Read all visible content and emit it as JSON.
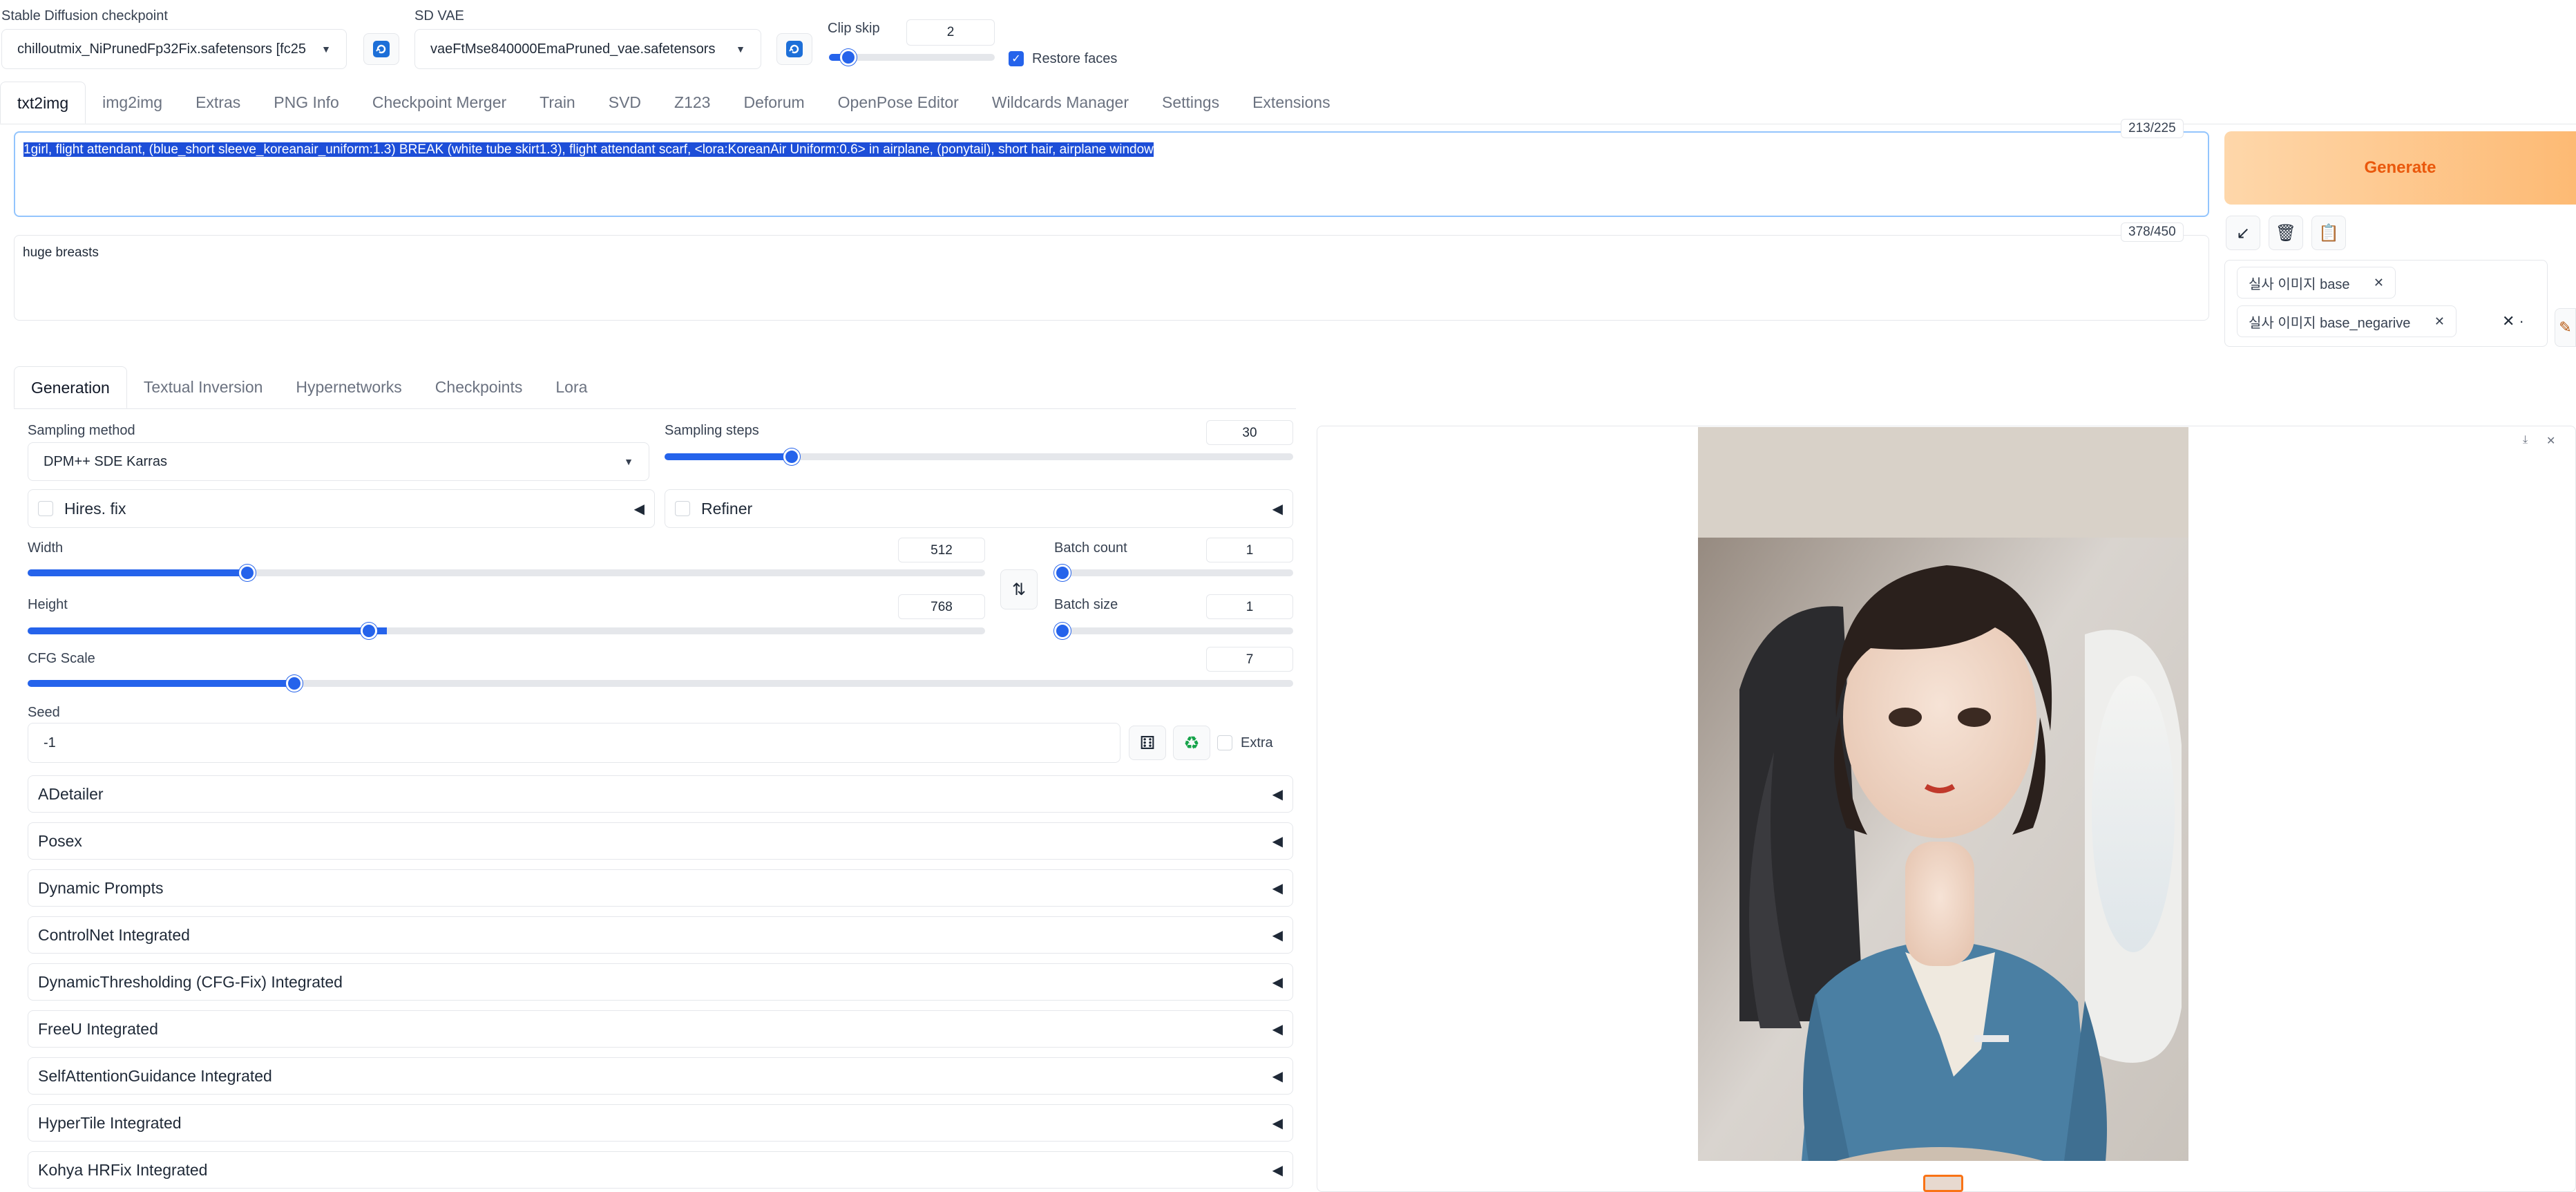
{
  "top": {
    "checkpoint_label": "Stable Diffusion checkpoint",
    "checkpoint_value": "chilloutmix_NiPrunedFp32Fix.safetensors [fc25",
    "vae_label": "SD VAE",
    "vae_value": "vaeFtMse840000EmaPruned_vae.safetensors",
    "clip_label": "Clip skip",
    "clip_value": "2",
    "clip_level": 0.1,
    "restore_faces_label": "Restore faces",
    "restore_faces_checked": true
  },
  "tabs": [
    "txt2img",
    "img2img",
    "Extras",
    "PNG Info",
    "Checkpoint Merger",
    "Train",
    "SVD",
    "Z123",
    "Deforum",
    "OpenPose Editor",
    "Wildcards Manager",
    "Settings",
    "Extensions"
  ],
  "prompt": {
    "text": "1girl, flight attendant, (blue_short sleeve_koreanair_uniform:1.3) BREAK (white tube skirt1.3), flight attendant scarf, <lora:KoreanAir Uniform:0.6> in airplane, (ponytail), short hair, airplane window",
    "counter": "213/225"
  },
  "negative": {
    "text": "huge breasts",
    "counter": "378/450"
  },
  "generate_label": "Generate",
  "styles": {
    "chips": [
      "실사 이미지 base",
      "실사 이미지 base_negarive"
    ]
  },
  "subtabs": [
    "Generation",
    "Textual Inversion",
    "Hypernetworks",
    "Checkpoints",
    "Lora"
  ],
  "gen": {
    "sampling_method_label": "Sampling method",
    "sampling_method_value": "DPM++ SDE Karras",
    "sampling_steps_label": "Sampling steps",
    "sampling_steps_value": "30",
    "hires_label": "Hires. fix",
    "refiner_label": "Refiner",
    "width_label": "Width",
    "width_value": "512",
    "height_label": "Height",
    "height_value": "768",
    "batch_count_label": "Batch count",
    "batch_count_value": "1",
    "batch_size_label": "Batch size",
    "batch_size_value": "1",
    "cfg_label": "CFG Scale",
    "cfg_value": "7",
    "seed_label": "Seed",
    "seed_value": "-1",
    "extra_label": "Extra"
  },
  "accordions": [
    "ADetailer",
    "Posex",
    "Dynamic Prompts",
    "ControlNet Integrated",
    "DynamicThresholding (CFG-Fix) Integrated",
    "FreeU Integrated",
    "SelfAttentionGuidance Integrated",
    "HyperTile Integrated",
    "Kohya HRFix Integrated"
  ],
  "colors": {
    "accent": "#2563eb",
    "generate_bg": "#fed7aa",
    "generate_text": "#ea580c"
  },
  "icons": {
    "refresh": "refresh-icon",
    "swap": "swap-dimensions-icon",
    "dice": "dice-icon",
    "recycle": "recycle-icon"
  }
}
